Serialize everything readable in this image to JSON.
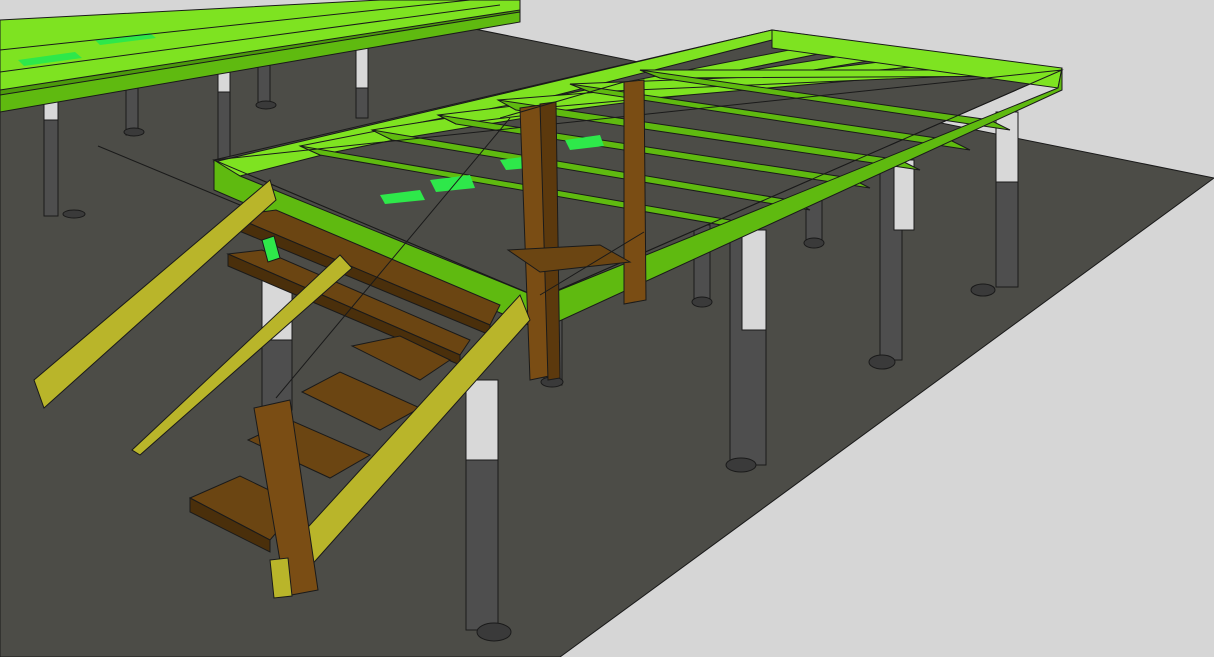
{
  "scene": {
    "background_color": "#d6d6d6",
    "ground_color": "#4c4c47",
    "joist_color": "#5fba10",
    "joist_top_color": "#7ee321",
    "joist_side_color": "#4c9a0c",
    "decking_color": "#6b4512",
    "post_color": "#7a4d14",
    "stringer_color": "#b9b52a",
    "pier_color": "#4e4e4e",
    "pier_sleeve_color": "#d8d8d8",
    "edge_color": "#1a1a1a"
  }
}
